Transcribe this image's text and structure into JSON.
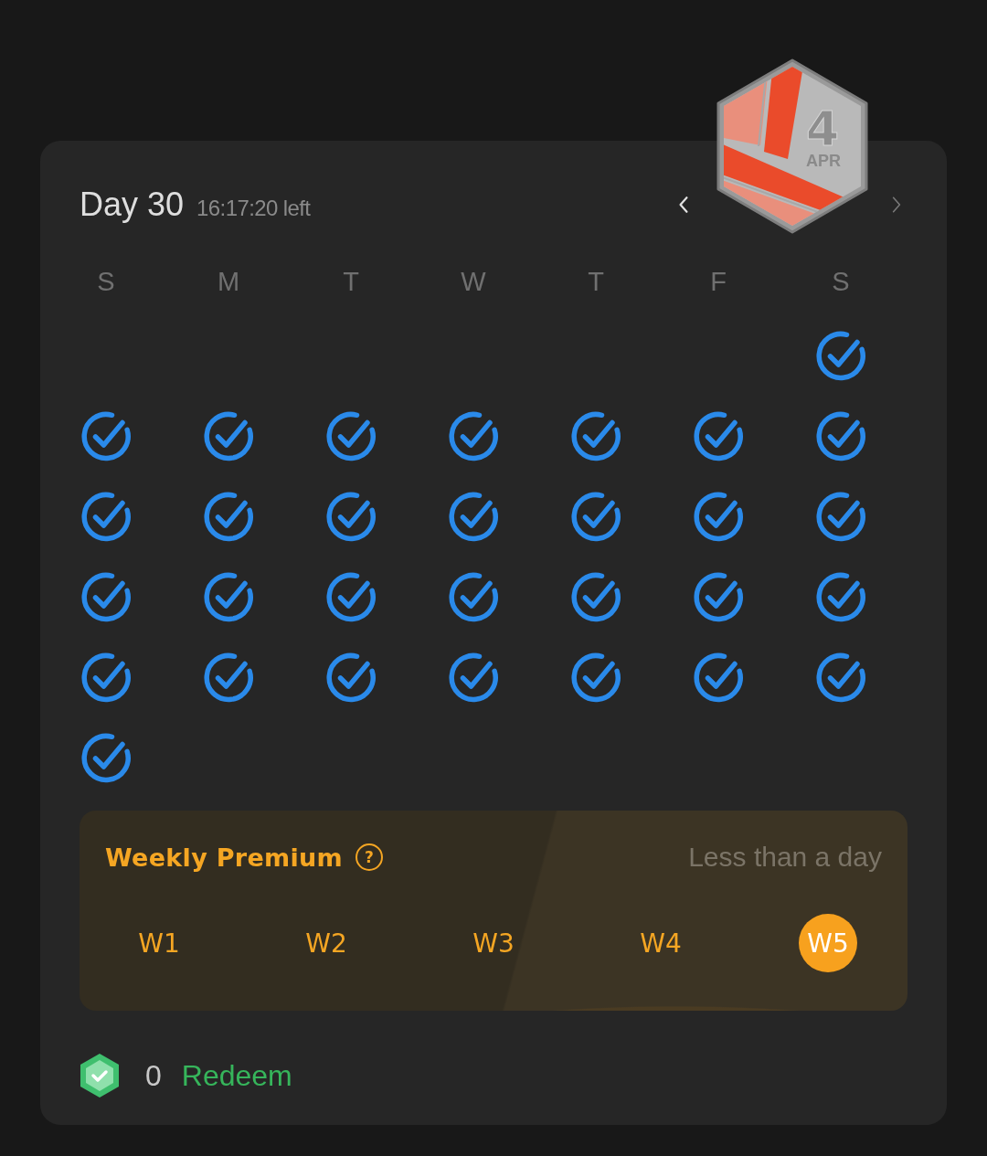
{
  "header": {
    "title": "Day 30",
    "countdown": "16:17:20 left",
    "prev": {
      "disabled": false
    },
    "next": {
      "disabled": true
    }
  },
  "badge": {
    "day": "4",
    "month": "APR"
  },
  "calendar": {
    "weekdays": [
      "S",
      "M",
      "T",
      "W",
      "T",
      "F",
      "S"
    ],
    "weeks": [
      [
        {
          "kind": "blank"
        },
        {
          "kind": "blank"
        },
        {
          "kind": "blank"
        },
        {
          "kind": "blank"
        },
        {
          "kind": "blank"
        },
        {
          "kind": "blank"
        },
        {
          "kind": "day",
          "checked": true
        }
      ],
      [
        {
          "kind": "day",
          "checked": true
        },
        {
          "kind": "day",
          "checked": true
        },
        {
          "kind": "day",
          "checked": true
        },
        {
          "kind": "day",
          "checked": true
        },
        {
          "kind": "day",
          "checked": true
        },
        {
          "kind": "day",
          "checked": true
        },
        {
          "kind": "day",
          "checked": true
        }
      ],
      [
        {
          "kind": "day",
          "checked": true
        },
        {
          "kind": "day",
          "checked": true
        },
        {
          "kind": "day",
          "checked": true
        },
        {
          "kind": "day",
          "checked": true
        },
        {
          "kind": "day",
          "checked": true
        },
        {
          "kind": "day",
          "checked": true
        },
        {
          "kind": "day",
          "checked": true
        }
      ],
      [
        {
          "kind": "day",
          "checked": true
        },
        {
          "kind": "day",
          "checked": true
        },
        {
          "kind": "day",
          "checked": true
        },
        {
          "kind": "day",
          "checked": true
        },
        {
          "kind": "day",
          "checked": true
        },
        {
          "kind": "day",
          "checked": true
        },
        {
          "kind": "day",
          "checked": true
        }
      ],
      [
        {
          "kind": "day",
          "checked": true
        },
        {
          "kind": "day",
          "checked": true
        },
        {
          "kind": "day",
          "checked": true
        },
        {
          "kind": "day",
          "checked": true
        },
        {
          "kind": "day",
          "checked": true
        },
        {
          "kind": "day",
          "checked": true
        },
        {
          "kind": "day",
          "checked": true
        }
      ],
      [
        {
          "kind": "day",
          "checked": true
        }
      ]
    ]
  },
  "weekly_premium": {
    "title": "Weekly Premium",
    "help": "?",
    "time_left": "Less than a day",
    "weeks": [
      {
        "label": "W1",
        "selected": false
      },
      {
        "label": "W2",
        "selected": false
      },
      {
        "label": "W3",
        "selected": false
      },
      {
        "label": "W4",
        "selected": false
      },
      {
        "label": "W5",
        "selected": true
      }
    ]
  },
  "footer": {
    "points": "0",
    "action": "Redeem"
  }
}
